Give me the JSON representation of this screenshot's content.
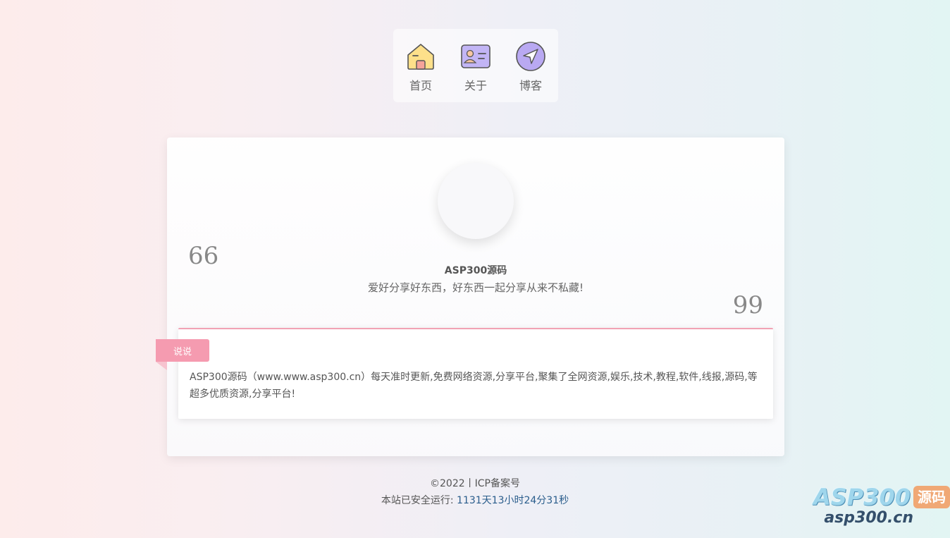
{
  "nav": {
    "items": [
      {
        "label": "首页",
        "icon": "home-icon"
      },
      {
        "label": "关于",
        "icon": "id-card-icon"
      },
      {
        "label": "博客",
        "icon": "navigation-arrow-icon"
      }
    ]
  },
  "profile": {
    "name": "ASP300源码",
    "motto": "爱好分享好东西，好东西一起分享从来不私藏!",
    "quote_open": "66",
    "quote_close": "99"
  },
  "talk": {
    "tag": "说说",
    "text": "ASP300源码（www.www.asp300.cn）每天准时更新,免费网络资源,分享平台,聚集了全网资源,娱乐,技术,教程,软件,线报,源码,等超多优质资源,分享平台!"
  },
  "footer": {
    "copyright": "©2022丨ICP备案号",
    "runtime_prefix": "本站已安全运行:",
    "runtime_value": "1131天13小时24分31秒"
  },
  "watermark": {
    "brand": "ASP300",
    "badge": "源码",
    "url": "asp300.cn"
  },
  "colors": {
    "accent_pink": "#f59bb0",
    "runtime_blue": "#2a5d8c"
  }
}
